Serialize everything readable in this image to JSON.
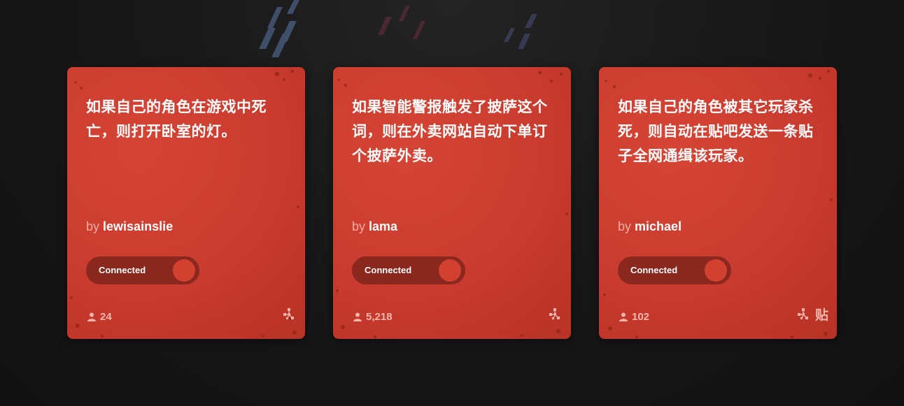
{
  "cards": [
    {
      "title": "如果自己的角色在游戏中死亡，则打开卧室的灯。",
      "by_label": "by",
      "author": "lewisainslie",
      "toggle_label": "Connected",
      "users": "24",
      "service_icon": "network-icon",
      "extra_service_glyph": ""
    },
    {
      "title": "如果智能警报触发了披萨这个词，则在外卖网站自动下单订个披萨外卖。",
      "by_label": "by",
      "author": "lama",
      "toggle_label": "Connected",
      "users": "5,218",
      "service_icon": "network-icon",
      "extra_service_glyph": ""
    },
    {
      "title": "如果自己的角色被其它玩家杀死，则自动在贴吧发送一条贴子全网通缉该玩家。",
      "by_label": "by",
      "author": "michael",
      "toggle_label": "Connected",
      "users": "102",
      "service_icon": "network-icon",
      "extra_service_glyph": "贴"
    }
  ],
  "colors": {
    "card": "#c93b2e",
    "toggle_track": "#8a271e",
    "toggle_knob": "#d2412f",
    "background": "#151515"
  }
}
